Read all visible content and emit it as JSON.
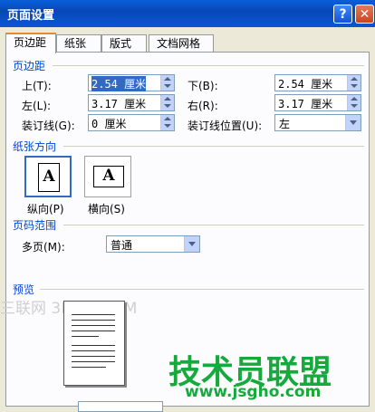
{
  "window": {
    "title": "页面设置"
  },
  "tabs": [
    {
      "label": "页边距"
    },
    {
      "label": "纸张"
    },
    {
      "label": "版式"
    },
    {
      "label": "文档网格"
    }
  ],
  "margins": {
    "section_title": "页边距",
    "top_label": "上(T):",
    "top_value": "2.54 厘米",
    "bottom_label": "下(B):",
    "bottom_value": "2.54 厘米",
    "left_label": "左(L):",
    "left_value": "3.17 厘米",
    "right_label": "右(R):",
    "right_value": "3.17 厘米",
    "gutter_label": "装订线(G):",
    "gutter_value": "0 厘米",
    "gutter_pos_label": "装订线位置(U):",
    "gutter_pos_value": "左"
  },
  "orientation": {
    "section_title": "纸张方向",
    "portrait_label": "纵向(P)",
    "landscape_label": "横向(S)",
    "icon_letter": "A"
  },
  "pages": {
    "section_title": "页码范围",
    "multiple_label": "多页(M):",
    "multiple_value": "普通"
  },
  "preview": {
    "section_title": "预览"
  },
  "watermarks": {
    "site_top": "三联网 3LIAN.COM",
    "brand": "技术员联盟",
    "url": "www.jsgho.com"
  },
  "colors": {
    "title_bar": "#0a5fd8",
    "section_text": "#0046d5",
    "watermark_green": "#16a93c"
  }
}
